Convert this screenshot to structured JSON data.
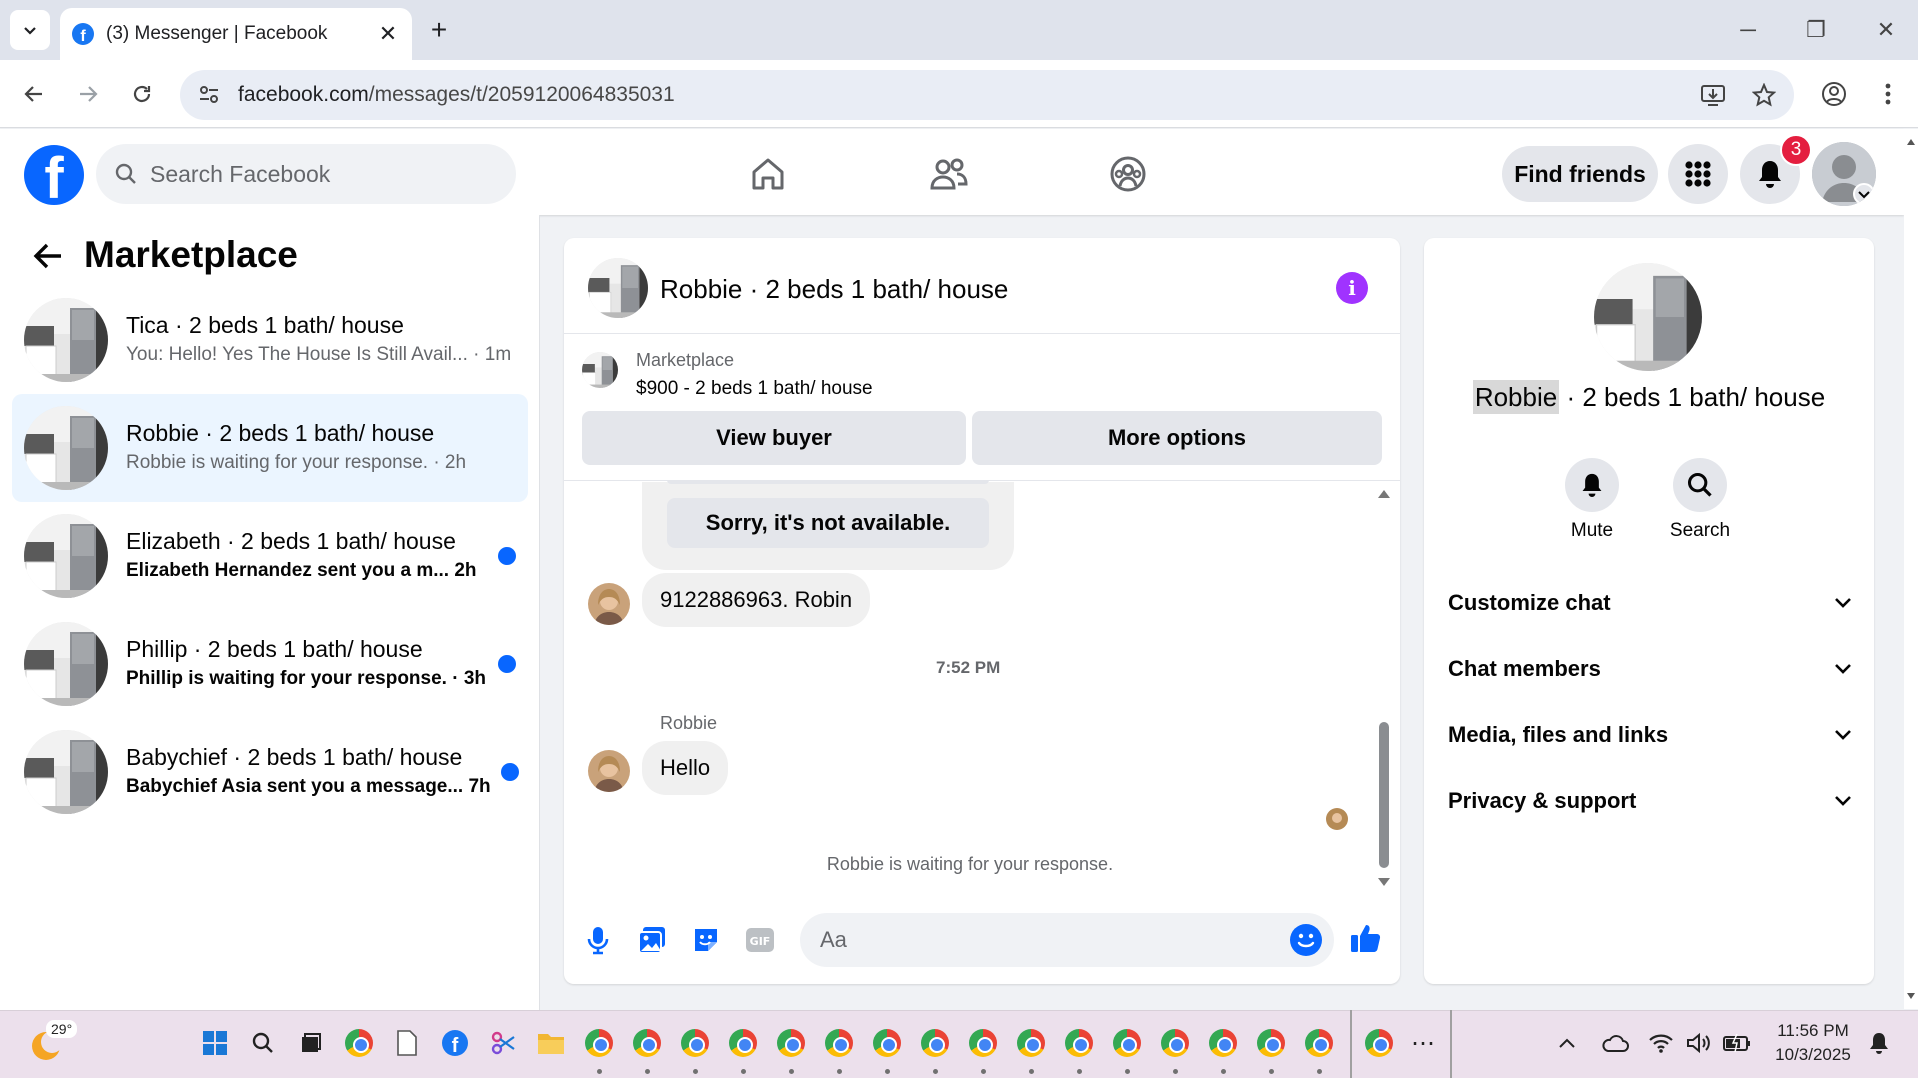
{
  "browser": {
    "tab_title": "(3) Messenger | Facebook",
    "url_domain": "facebook.com",
    "url_path": "/messages/t/2059120064835031"
  },
  "header": {
    "search_placeholder": "Search Facebook",
    "find_friends": "Find friends",
    "notification_count": "3"
  },
  "sidebar": {
    "title": "Marketplace",
    "conversations": [
      {
        "name": "Tica · 2 beds 1 bath/ house",
        "preview": "You: Hello! Yes The House Is Still Avail... · 1m",
        "unread": false
      },
      {
        "name": "Robbie · 2 beds 1 bath/ house",
        "preview": "Robbie is waiting for your response. · 2h",
        "unread": false
      },
      {
        "name": "Elizabeth · 2 beds 1 bath/ house",
        "preview": "Elizabeth Hernandez sent you a m...  2h",
        "unread": true
      },
      {
        "name": "Phillip · 2 beds 1 bath/ house",
        "preview": "Phillip is waiting for your response. · 3h",
        "unread": true
      },
      {
        "name": "Babychief · 2 beds 1 bath/ house",
        "preview": "Babychief Asia sent you a message...  7h",
        "unread": true
      }
    ]
  },
  "chat": {
    "title": "Robbie · 2 beds 1 bath/ house",
    "listing_label": "Marketplace",
    "listing_title": "$900 - 2 beds 1 bath/ house",
    "view_buyer": "View buyer",
    "more_options": "More options",
    "quick_reply": "Sorry, it's not available.",
    "message_phone": "9122886963.   Robin",
    "timestamp": "7:52 PM",
    "sender_name": "Robbie",
    "message_hello": "Hello",
    "waiting_note": "Robbie is waiting for your response.",
    "input_placeholder": "Aa"
  },
  "info_panel": {
    "name_highlight": "Robbie",
    "name_rest": " · 2 beds 1 bath/ house",
    "mute_label": "Mute",
    "search_label": "Search",
    "sections": [
      "Customize chat",
      "Chat members",
      "Media, files and links",
      "Privacy & support"
    ]
  },
  "taskbar": {
    "weather_temp": "29°",
    "time": "11:56 PM",
    "date": "10/3/2025"
  },
  "colors": {
    "fb_blue": "#0866ff",
    "active_conv": "#ebf5ff",
    "badge_red": "#e41e3f",
    "info_purple": "#a033ff"
  }
}
